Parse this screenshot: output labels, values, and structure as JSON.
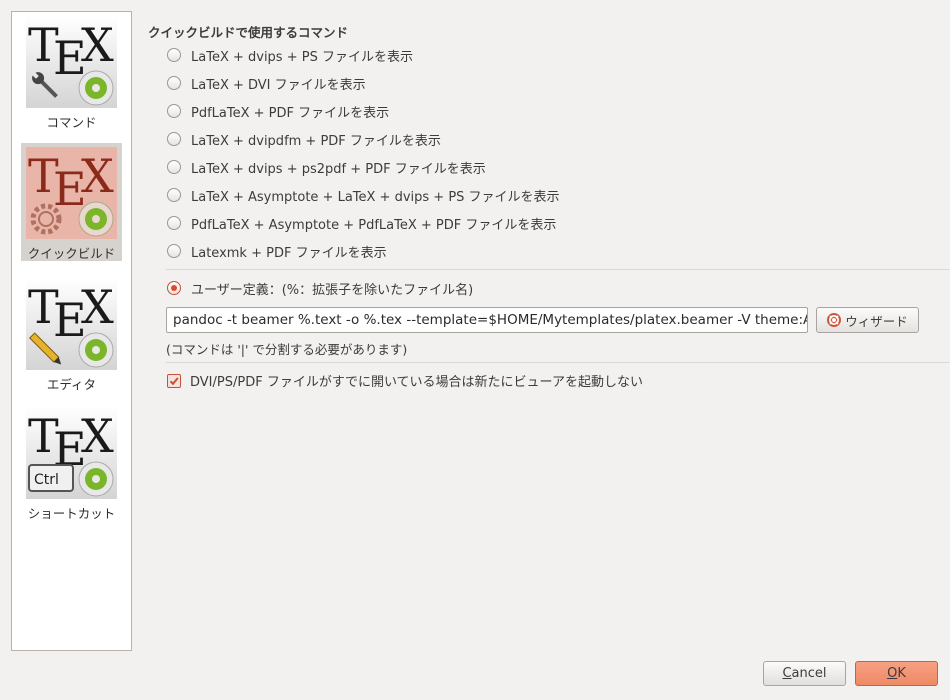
{
  "sidebar": {
    "items": [
      {
        "label": "コマンド",
        "icon": "tex-wrench-gear-icon",
        "selected": false
      },
      {
        "label": "クイックビルド",
        "icon": "tex-gear-gear-icon",
        "selected": true
      },
      {
        "label": "エディタ",
        "icon": "tex-pencil-gear-icon",
        "selected": false
      },
      {
        "label": "ショートカット",
        "icon": "tex-ctrl-gear-icon",
        "selected": false
      }
    ],
    "icon_text": "TEX",
    "ctrl_key": "Ctrl"
  },
  "quickbuild": {
    "title": "クイックビルドで使用するコマンド",
    "options": [
      "LaTeX + dvips + PS ファイルを表示",
      "LaTeX + DVI ファイルを表示",
      "PdfLaTeX + PDF ファイルを表示",
      "LaTeX + dvipdfm + PDF ファイルを表示",
      "LaTeX + dvips + ps2pdf + PDF ファイルを表示",
      "LaTeX + Asymptote + LaTeX + dvips + PS ファイルを表示",
      "PdfLaTeX + Asymptote + PdfLaTeX + PDF ファイルを表示",
      "Latexmk + PDF ファイルを表示"
    ],
    "user_defined_label": "ユーザー定義：(%：拡張子を除いたファイル名)",
    "user_defined_selected": true,
    "command_value": "pandoc -t beamer %.text -o %.tex --template=$HOME/Mytemplates/platex.beamer -V theme:An",
    "wizard_label": "ウィザード",
    "hint": "(コマンドは '|' で分割する必要があります)",
    "no_new_viewer_label": "DVI/PS/PDF ファイルがすでに開いている場合は新たにビューアを起動しない",
    "no_new_viewer_checked": true
  },
  "footer": {
    "cancel_label": "Cancel",
    "cancel_mnemonic": "C",
    "cancel_rest": "ancel",
    "ok_label": "OK",
    "ok_mnemonic": "O",
    "ok_rest": "K"
  },
  "colors": {
    "accent": "#de4b2c",
    "ok_button": "#ee8a66",
    "selected_item": "#d6d3cf",
    "gear_green": "#7ab52a"
  }
}
